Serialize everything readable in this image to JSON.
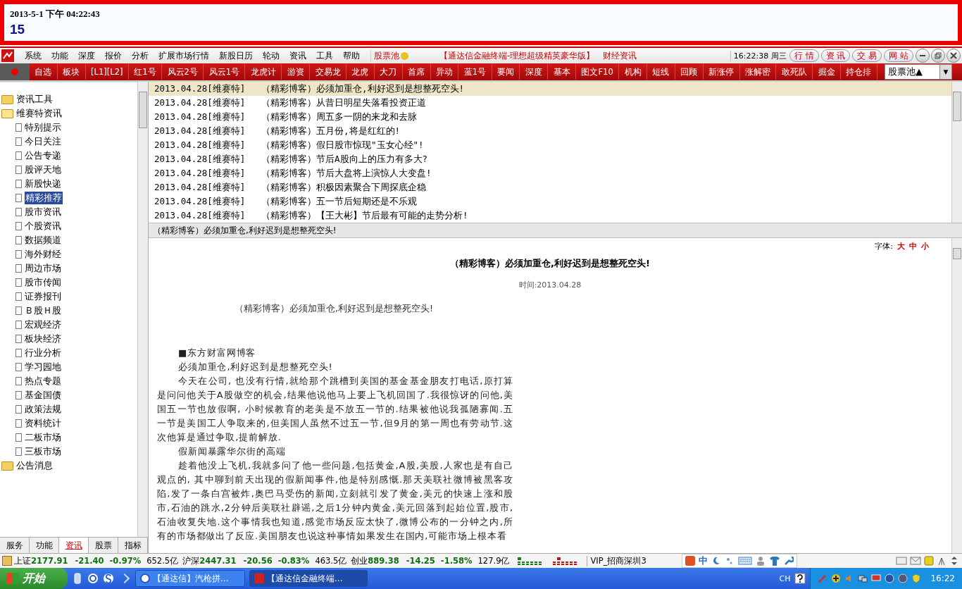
{
  "clock_panel": {
    "datetime": "2013-5-1 下午 04:22:43",
    "count": "15"
  },
  "menu_bar": {
    "items": [
      "系统",
      "功能",
      "深度",
      "报价",
      "分析",
      "扩展市场行情",
      "新股日历",
      "轮动",
      "资讯",
      "工具",
      "帮助"
    ],
    "stock_pool": "股票池",
    "title": "【通达信金融终端-理想超级精英豪华版】",
    "section": "财经资讯",
    "time": "16:22:38 周三",
    "buttons": [
      "行 情",
      "资 讯",
      "交 易",
      "网 站"
    ]
  },
  "toolbar": {
    "items": [
      "自选",
      "板块",
      "[L1][L2]",
      "红1号",
      "风云2号",
      "风云1号",
      "龙虎计",
      "游资",
      "交易龙",
      "龙虎",
      "大刀",
      "首席",
      "异动",
      "蓝1号",
      "要闻",
      "深度",
      "基本",
      "图文F10",
      "机构",
      "短线",
      "回顾",
      "新涨停",
      "涨解密",
      "敢死队",
      "掘金",
      "持仓排"
    ],
    "dropdown": "股票池▲",
    "dropdown_arrow": "▼"
  },
  "sidebar": {
    "items": [
      {
        "label": "资讯工具",
        "expanded": false,
        "selected": false
      },
      {
        "label": "维赛特资讯",
        "expanded": true,
        "selected": false,
        "children": [
          {
            "label": "特别提示",
            "selected": false
          },
          {
            "label": "今日关注",
            "selected": false
          },
          {
            "label": "公告专递",
            "selected": false
          },
          {
            "label": "股评天地",
            "selected": false
          },
          {
            "label": "新股快递",
            "selected": false
          },
          {
            "label": "精彩推荐",
            "selected": true
          },
          {
            "label": "股市资讯",
            "selected": false
          },
          {
            "label": "个股资讯",
            "selected": false
          },
          {
            "label": "数据频道",
            "selected": false
          },
          {
            "label": "海外财经",
            "selected": false
          },
          {
            "label": "周边市场",
            "selected": false
          },
          {
            "label": "股市传闻",
            "selected": false
          },
          {
            "label": "证券报刊",
            "selected": false
          },
          {
            "label": "Ｂ股Ｈ股",
            "selected": false
          },
          {
            "label": "宏观经济",
            "selected": false
          },
          {
            "label": "板块经济",
            "selected": false
          },
          {
            "label": "行业分析",
            "selected": false
          },
          {
            "label": "学习园地",
            "selected": false
          },
          {
            "label": "热点专题",
            "selected": false
          },
          {
            "label": "基金国债",
            "selected": false
          },
          {
            "label": "政策法规",
            "selected": false
          },
          {
            "label": "资料统计",
            "selected": false
          },
          {
            "label": "二板市场",
            "selected": false
          },
          {
            "label": "三板市场",
            "selected": false
          }
        ]
      },
      {
        "label": "公告消息",
        "expanded": false,
        "selected": false
      }
    ],
    "tabs": [
      {
        "label": "服务",
        "selected": false
      },
      {
        "label": "功能",
        "selected": false
      },
      {
        "label": "资讯",
        "selected": true
      },
      {
        "label": "股票",
        "selected": false
      },
      {
        "label": "指标",
        "selected": false
      }
    ]
  },
  "news_list": [
    {
      "source": "2013.04.28[维赛特]",
      "title": "（精彩博客）必须加重仓,利好迟到是想整死空头!",
      "selected": true
    },
    {
      "source": "2013.04.28[维赛特]",
      "title": "（精彩博客）从昔日明星失落看投资正道",
      "selected": false
    },
    {
      "source": "2013.04.28[维赛特]",
      "title": "（精彩博客）周五多一阴的来龙和去脉",
      "selected": false
    },
    {
      "source": "2013.04.28[维赛特]",
      "title": "（精彩博客）五月份,将是红红的!",
      "selected": false
    },
    {
      "source": "2013.04.28[维赛特]",
      "title": "（精彩博客）假日股市惊现\"玉女心经\"!",
      "selected": false
    },
    {
      "source": "2013.04.28[维赛特]",
      "title": "（精彩博客）节后A股向上的压力有多大?",
      "selected": false
    },
    {
      "source": "2013.04.28[维赛特]",
      "title": "（精彩博客）节后大盘将上演惊人大变盘!",
      "selected": false
    },
    {
      "source": "2013.04.28[维赛特]",
      "title": "（精彩博客）积极因素聚合下周探底企稳",
      "selected": false
    },
    {
      "source": "2013.04.28[维赛特]",
      "title": "（精彩博客）五一节后短期还是不乐观",
      "selected": false
    },
    {
      "source": "2013.04.28[维赛特]",
      "title": "（精彩博客）【王大彬】节后最有可能的走势分析!",
      "selected": false
    }
  ],
  "preview_bar": "（精彩博客）必须加重仓,利好迟到是想整死空头!",
  "article": {
    "font_label": "字体:",
    "font_sizes": [
      "大",
      "中",
      "小"
    ],
    "title": "（精彩博客）必须加重仓,利好迟到是想整死空头!",
    "time": "时间:2013.04.28",
    "intro": "（精彩博客）必须加重仓,利好迟到是想整死空头!",
    "paragraphs": [
      "■东方财富网博客",
      "必须加重仓,利好迟到是想整死空头!",
      "今天在公司, 也没有行情,就给那个跳槽到美国的基金基金朋友打电话,原打算是问问他关于A股做空的机会,结果他说他马上要上飞机回国了.我很惊讶的问他,美国五一节也放假啊, 小时候教育的老美是不放五一节的.结果被他说我孤陋寡闻.五一节是美国工人争取来的,但美国人虽然不过五一节,但9月的第一周也有劳动节.这次他算是通过争取,提前解放.",
      "假新闻暴露华尔街的高端",
      "趁着他没上飞机,我就多问了他一些问题,包括黄金,A股,美股,人家也是有自己观点的, 其中聊到前天出现的假新闻事件,他是特别感慨.那天美联社微博被黑客攻陷,发了一条白宫被炸,奥巴马受伤的新闻,立刻就引发了黄金,美元的快速上涨和股市,石油的跳水,2分钟后美联社辟谣,之后1分钟内黄金,美元回落到起始位置,股市,石油收复失地.这个事情我也知道,感觉市场反应太快了,微博公布的一分钟之内,所有的市场都做出了反应.美国朋友也说这种事情如果发生在国内,可能市场上根本看"
    ]
  },
  "status_bar": {
    "indices": [
      {
        "name": "上证",
        "value": "2177.91",
        "change": "-21.40",
        "percent": "-0.97%",
        "amount": "652.5亿"
      },
      {
        "name": "沪深",
        "value": "2447.31",
        "change": "-20.56",
        "percent": "-0.83%",
        "amount": "463.5亿"
      },
      {
        "name": "创业",
        "value": "889.38",
        "change": "-14.25",
        "percent": "-1.58%",
        "amount": "127.9亿"
      }
    ],
    "server": "VIP_招商深圳3",
    "ime": "中"
  },
  "taskbar": {
    "start": "开始",
    "tasks": [
      {
        "label": "【通达信】汽枪拼...",
        "selected": false
      },
      {
        "label": "【通达信金融终端...",
        "selected": true
      }
    ],
    "lang": "CH",
    "clock": "16:22"
  }
}
